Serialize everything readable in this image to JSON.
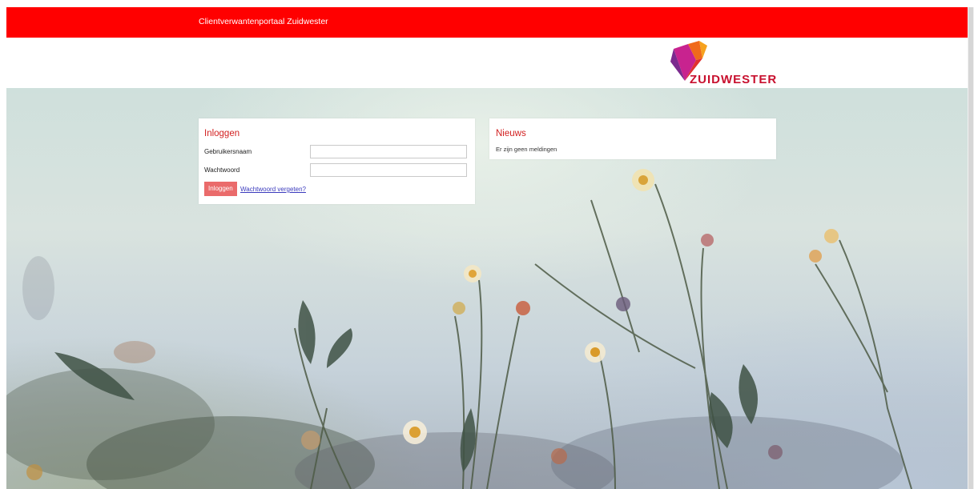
{
  "header": {
    "title": "Clientverwantenportaal Zuidwester",
    "background_color": "#ff0000"
  },
  "logo": {
    "text": "ZUIDWESTER",
    "icon": "zuidwester-heart-logo-icon"
  },
  "login": {
    "title": "Inloggen",
    "username_label": "Gebruikersnaam",
    "username_value": "",
    "password_label": "Wachtwoord",
    "password_value": "",
    "submit_label": "Inloggen",
    "forgot_link": "Wachtwoord vergeten?",
    "accent_color": "#d21f1f",
    "button_color": "#ea6b6b"
  },
  "news": {
    "title": "Nieuws",
    "message": "Er zijn geen meldingen"
  },
  "background": {
    "image": "wildflowers-sky-photo"
  }
}
